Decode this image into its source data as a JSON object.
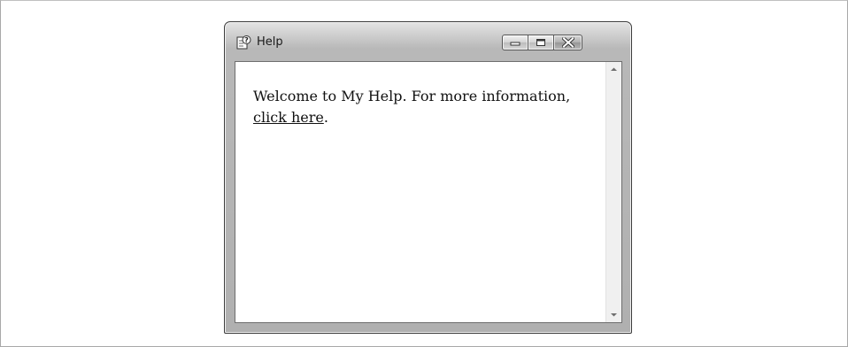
{
  "window": {
    "title": "Help",
    "icon": "help-document-icon",
    "controls": {
      "minimize": "minimize-icon",
      "maximize": "maximize-icon",
      "close": "close-icon"
    }
  },
  "content": {
    "text_before": "Welcome to My Help. For more information, ",
    "link_text": "click here",
    "text_after": "."
  },
  "scrollbar": {
    "up": "scroll-up-arrow-icon",
    "down": "scroll-down-arrow-icon"
  }
}
